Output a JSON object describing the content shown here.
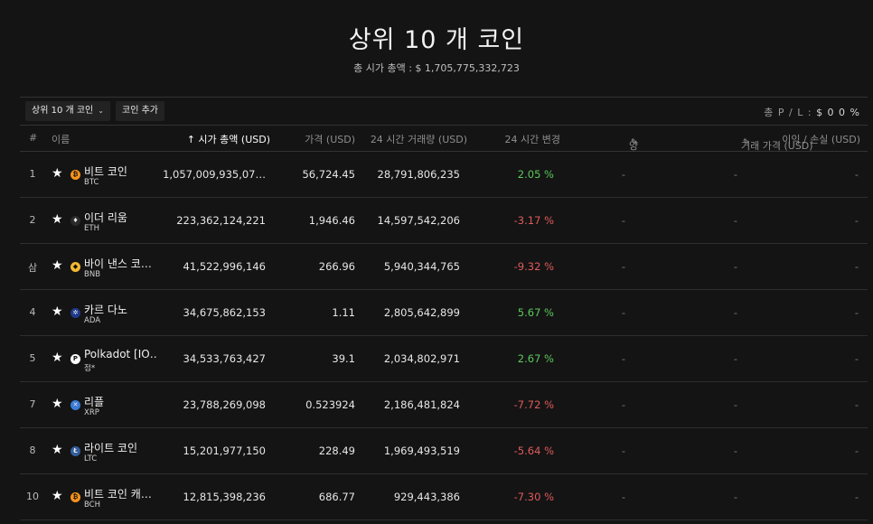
{
  "page": {
    "title": "상위 10 개 코인",
    "total_mcap": "총 시가 총액 : $ 1,705,775,332,723"
  },
  "toolbar": {
    "select_label": "상위 10 개 코인",
    "add_coin_label": "코인 추가",
    "pl_label": "총 P / L :",
    "pl_value": "$ 0 0 %"
  },
  "headers": {
    "rank": "#",
    "name": "이름",
    "mcap": "↑ 시가 총액 (USD)",
    "price": "가격 (USD)",
    "volume": "24 시간 거래량 (USD)",
    "change": "24 시간 변경",
    "holdings": "양",
    "cost": "거래 가격 (USD)",
    "pnl": "이익 / 손실 (USD)"
  },
  "rows": [
    {
      "rank": "1",
      "name": "비트 코인",
      "symbol": "BTC",
      "mcap": "1,057,009,935,07…",
      "price": "56,724.45",
      "volume": "28,791,806,235",
      "change": "2.05 %",
      "dir": "pos",
      "icon": "bitcoin-icon",
      "icon_color": "#f7931a",
      "icon_glyph": "₿"
    },
    {
      "rank": "2",
      "name": "이더 리움",
      "symbol": "ETH",
      "mcap": "223,362,124,221",
      "price": "1,946.46",
      "volume": "14,597,542,206",
      "change": "-3.17 %",
      "dir": "neg",
      "icon": "ethereum-icon",
      "icon_color": "#2a2a2a",
      "icon_glyph": "♦"
    },
    {
      "rank": "삼",
      "name": "바이 낸스 코…",
      "symbol": "BNB",
      "mcap": "41,522,996,146",
      "price": "266.96",
      "volume": "5,940,344,765",
      "change": "-9.32 %",
      "dir": "neg",
      "icon": "binance-icon",
      "icon_color": "#f3ba2f",
      "icon_glyph": "◆"
    },
    {
      "rank": "4",
      "name": "카르 다노",
      "symbol": "ADA",
      "mcap": "34,675,862,153",
      "price": "1.11",
      "volume": "2,805,642,899",
      "change": "5.67 %",
      "dir": "pos",
      "icon": "cardano-icon",
      "icon_color": "#1f3a8a",
      "icon_glyph": "✲"
    },
    {
      "rank": "5",
      "name": "Polkadot [IO…",
      "symbol": "점*",
      "mcap": "34,533,763,427",
      "price": "39.1",
      "volume": "2,034,802,971",
      "change": "2.67 %",
      "dir": "pos",
      "icon": "polkadot-icon",
      "icon_color": "#ffffff",
      "icon_glyph": "P"
    },
    {
      "rank": "7",
      "name": "리플",
      "symbol": "XRP",
      "mcap": "23,788,269,098",
      "price": "0.523924",
      "volume": "2,186,481,824",
      "change": "-7.72 %",
      "dir": "neg",
      "icon": "ripple-icon",
      "icon_color": "#3a7bd5",
      "icon_glyph": "✕"
    },
    {
      "rank": "8",
      "name": "라이트 코인",
      "symbol": "LTC",
      "mcap": "15,201,977,150",
      "price": "228.49",
      "volume": "1,969,493,519",
      "change": "-5.64 %",
      "dir": "neg",
      "icon": "litecoin-icon",
      "icon_color": "#345d9d",
      "icon_glyph": "Ł"
    },
    {
      "rank": "10",
      "name": "비트 코인 캐…",
      "symbol": "BCH",
      "mcap": "12,815,398,236",
      "price": "686.77",
      "volume": "929,443,386",
      "change": "-7.30 %",
      "dir": "neg",
      "icon": "bitcoin-cash-icon",
      "icon_color": "#f7931a",
      "icon_glyph": "₿"
    }
  ],
  "placeholder": "-",
  "colors": {
    "positive": "#5cc85c",
    "negative": "#e05a5a"
  }
}
